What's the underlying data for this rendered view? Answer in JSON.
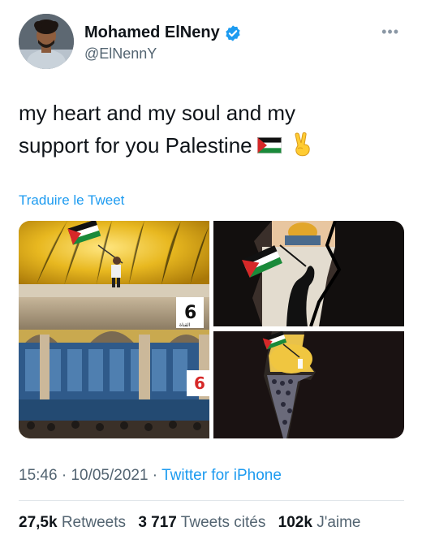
{
  "author": {
    "name": "Mohamed ElNeny",
    "handle": "@ElNennY",
    "verified": true
  },
  "more_icon": "more-horizontal-icon",
  "tweet": {
    "line1": "my heart and my soul and my",
    "line2": "support for you  Palestine",
    "emoji": [
      "palestine-flag",
      "victory-hand"
    ]
  },
  "translate_label": "Traduire le Tweet",
  "images": [
    {
      "name": "dome-of-the-rock-flag-photo",
      "overlay_numbers": [
        "6",
        "6"
      ],
      "overlay_caption": "القناة"
    },
    {
      "name": "cracked-wall-silhouette-flag-image"
    },
    {
      "name": "palestine-map-crowd-image"
    }
  ],
  "meta": {
    "time": "15:46",
    "sep1": " · ",
    "date": "10/05/2021",
    "sep2": " · ",
    "source": "Twitter for iPhone"
  },
  "stats": {
    "retweets_count": "27,5k",
    "retweets_label": "Retweets",
    "quotes_count": "3 717",
    "quotes_label": "Tweets cités",
    "likes_count": "102k",
    "likes_label": "J'aime"
  },
  "colors": {
    "accent": "#1d9bf0",
    "secondary_text": "#536471",
    "primary_text": "#0f1419"
  }
}
